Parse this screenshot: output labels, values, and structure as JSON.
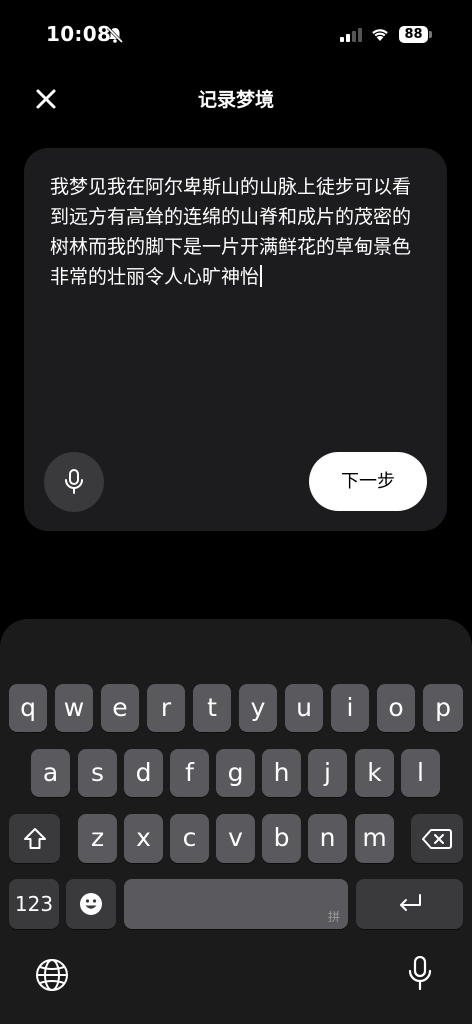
{
  "status_bar": {
    "time": "10:08",
    "battery": "88"
  },
  "header": {
    "title": "记录梦境"
  },
  "dream": {
    "text": "我梦见我在阿尔卑斯山的山脉上徒步可以看到远方有高耸的连绵的山脊和成片的茂密的树林而我的脚下是一片开满鲜花的草甸景色非常的壮丽令人心旷神怡"
  },
  "actions": {
    "next_label": "下一步"
  },
  "keyboard": {
    "row1": [
      "q",
      "w",
      "e",
      "r",
      "t",
      "y",
      "u",
      "i",
      "o",
      "p"
    ],
    "row2": [
      "a",
      "s",
      "d",
      "f",
      "g",
      "h",
      "j",
      "k",
      "l"
    ],
    "row3": [
      "z",
      "x",
      "c",
      "v",
      "b",
      "n",
      "m"
    ],
    "numbers_label": "123",
    "space_hint": "拼"
  }
}
